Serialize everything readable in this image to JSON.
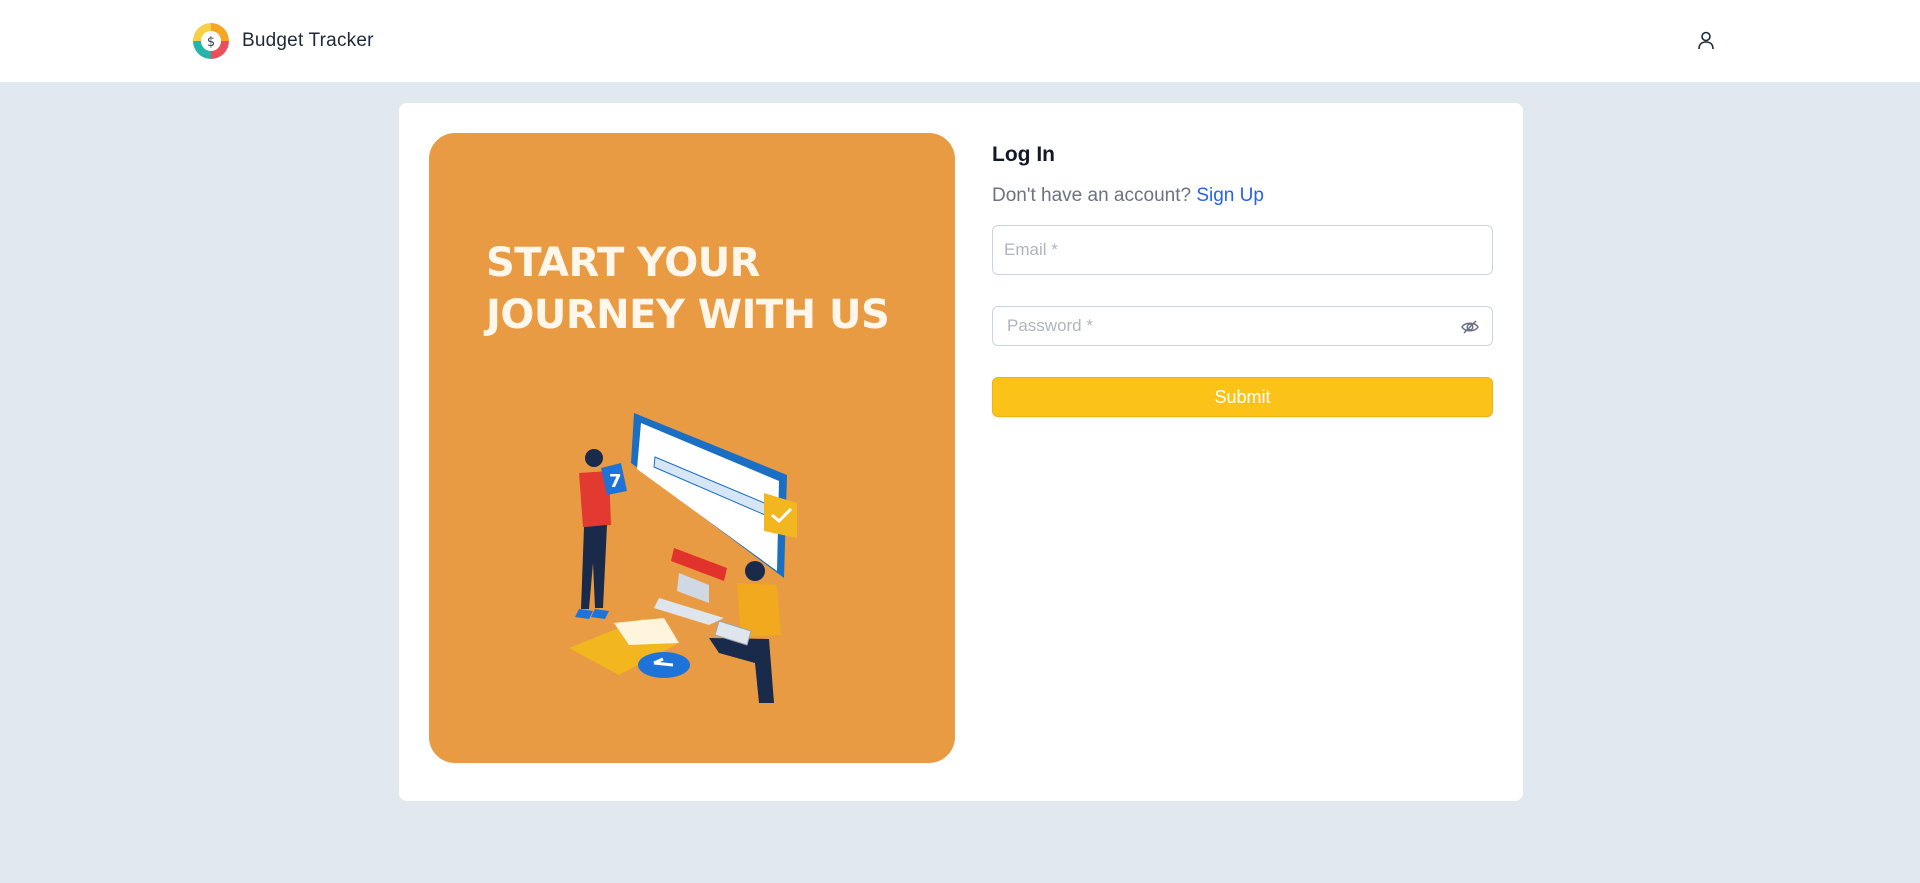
{
  "app": {
    "title": "Budget Tracker",
    "logo_icon": "dollar-pie-logo",
    "user_icon": "user-icon"
  },
  "hero": {
    "title": "START YOUR JOURNEY WITH US",
    "background": "#e89b42"
  },
  "login": {
    "title": "Log In",
    "signup_prompt": "Don't have an account?",
    "signup_link": "Sign Up",
    "email_placeholder": "Email *",
    "email_value": "",
    "password_placeholder": "Password *",
    "password_value": "",
    "password_toggle_icon": "eye-off-icon",
    "submit_label": "Submit"
  },
  "colors": {
    "accent": "#fbc318",
    "link": "#2563eb",
    "page_bg": "#e2e8f0"
  }
}
